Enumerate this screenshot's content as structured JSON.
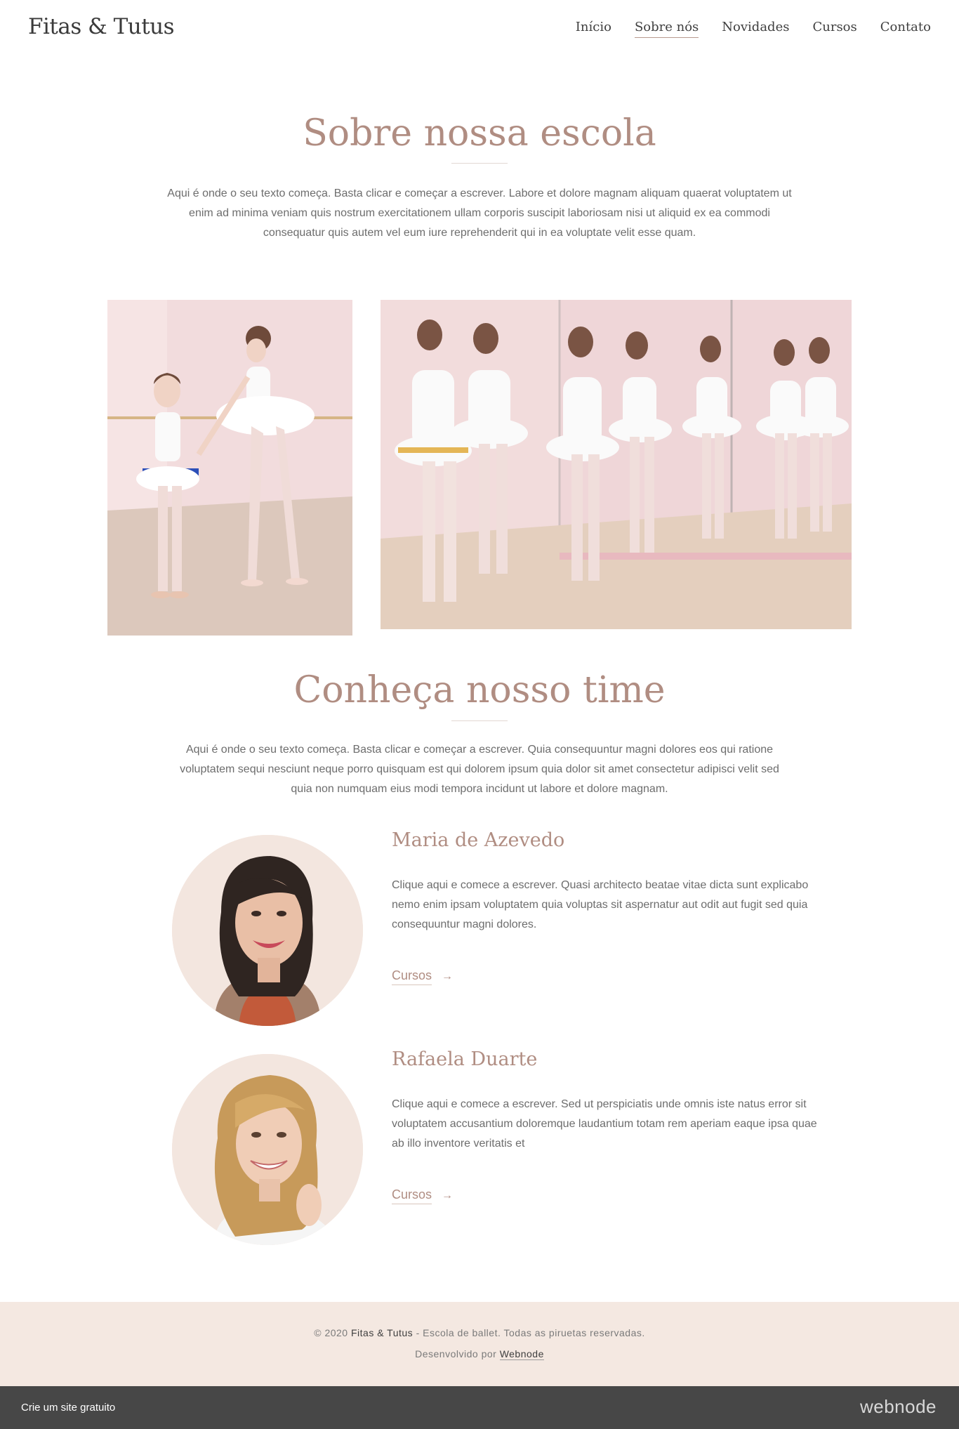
{
  "header": {
    "logo": "Fitas & Tutus",
    "nav": [
      {
        "label": "Início",
        "active": false
      },
      {
        "label": "Sobre nós",
        "active": true
      },
      {
        "label": "Novidades",
        "active": false
      },
      {
        "label": "Cursos",
        "active": false
      },
      {
        "label": "Contato",
        "active": false
      }
    ]
  },
  "about": {
    "title": "Sobre nossa escola",
    "text": "Aqui é onde o seu texto começa. Basta clicar e começar a escrever. Labore et dolore magnam aliquam quaerat voluptatem ut enim ad minima veniam quis nostrum exercitationem ullam corporis suscipit laboriosam nisi ut aliquid ex ea commodi consequatur quis autem vel eum iure reprehenderit qui in ea voluptate velit esse quam."
  },
  "team": {
    "title": "Conheça nosso time",
    "text": "Aqui é onde o seu texto começa. Basta clicar e começar a escrever. Quia consequuntur magni dolores eos qui ratione voluptatem sequi nesciunt neque porro quisquam est qui dolorem ipsum quia dolor sit amet consectetur adipisci velit sed quia non numquam eius modi tempora incidunt ut labore et dolore magnam.",
    "members": [
      {
        "name": "Maria de Azevedo",
        "text": "Clique aqui e comece a escrever. Quasi architecto beatae vitae dicta sunt explicabo nemo enim ipsam voluptatem quia voluptas sit aspernatur aut odit aut fugit sed quia consequuntur magni dolores.",
        "link": "Cursos"
      },
      {
        "name": "Rafaela Duarte",
        "text": "Clique aqui e comece a escrever. Sed ut perspiciatis unde omnis iste natus error sit voluptatem accusantium doloremque laudantium totam rem aperiam eaque ipsa quae ab illo inventore veritatis et",
        "link": "Cursos"
      }
    ]
  },
  "footer": {
    "copyright_prefix": "© 2020",
    "brand": "Fitas & Tutus",
    "copyright_suffix": "- Escola de ballet. Todas as piruetas reservadas.",
    "dev_prefix": "Desenvolvido por",
    "dev_link": "Webnode"
  },
  "bottombar": {
    "cta": "Crie um site gratuito",
    "brand": "webnode"
  },
  "icons": {
    "arrow": "arrow-right-icon"
  },
  "colors": {
    "accent": "#b08d82",
    "footer_bg": "#f4e8e1",
    "bar_bg": "#474747"
  }
}
